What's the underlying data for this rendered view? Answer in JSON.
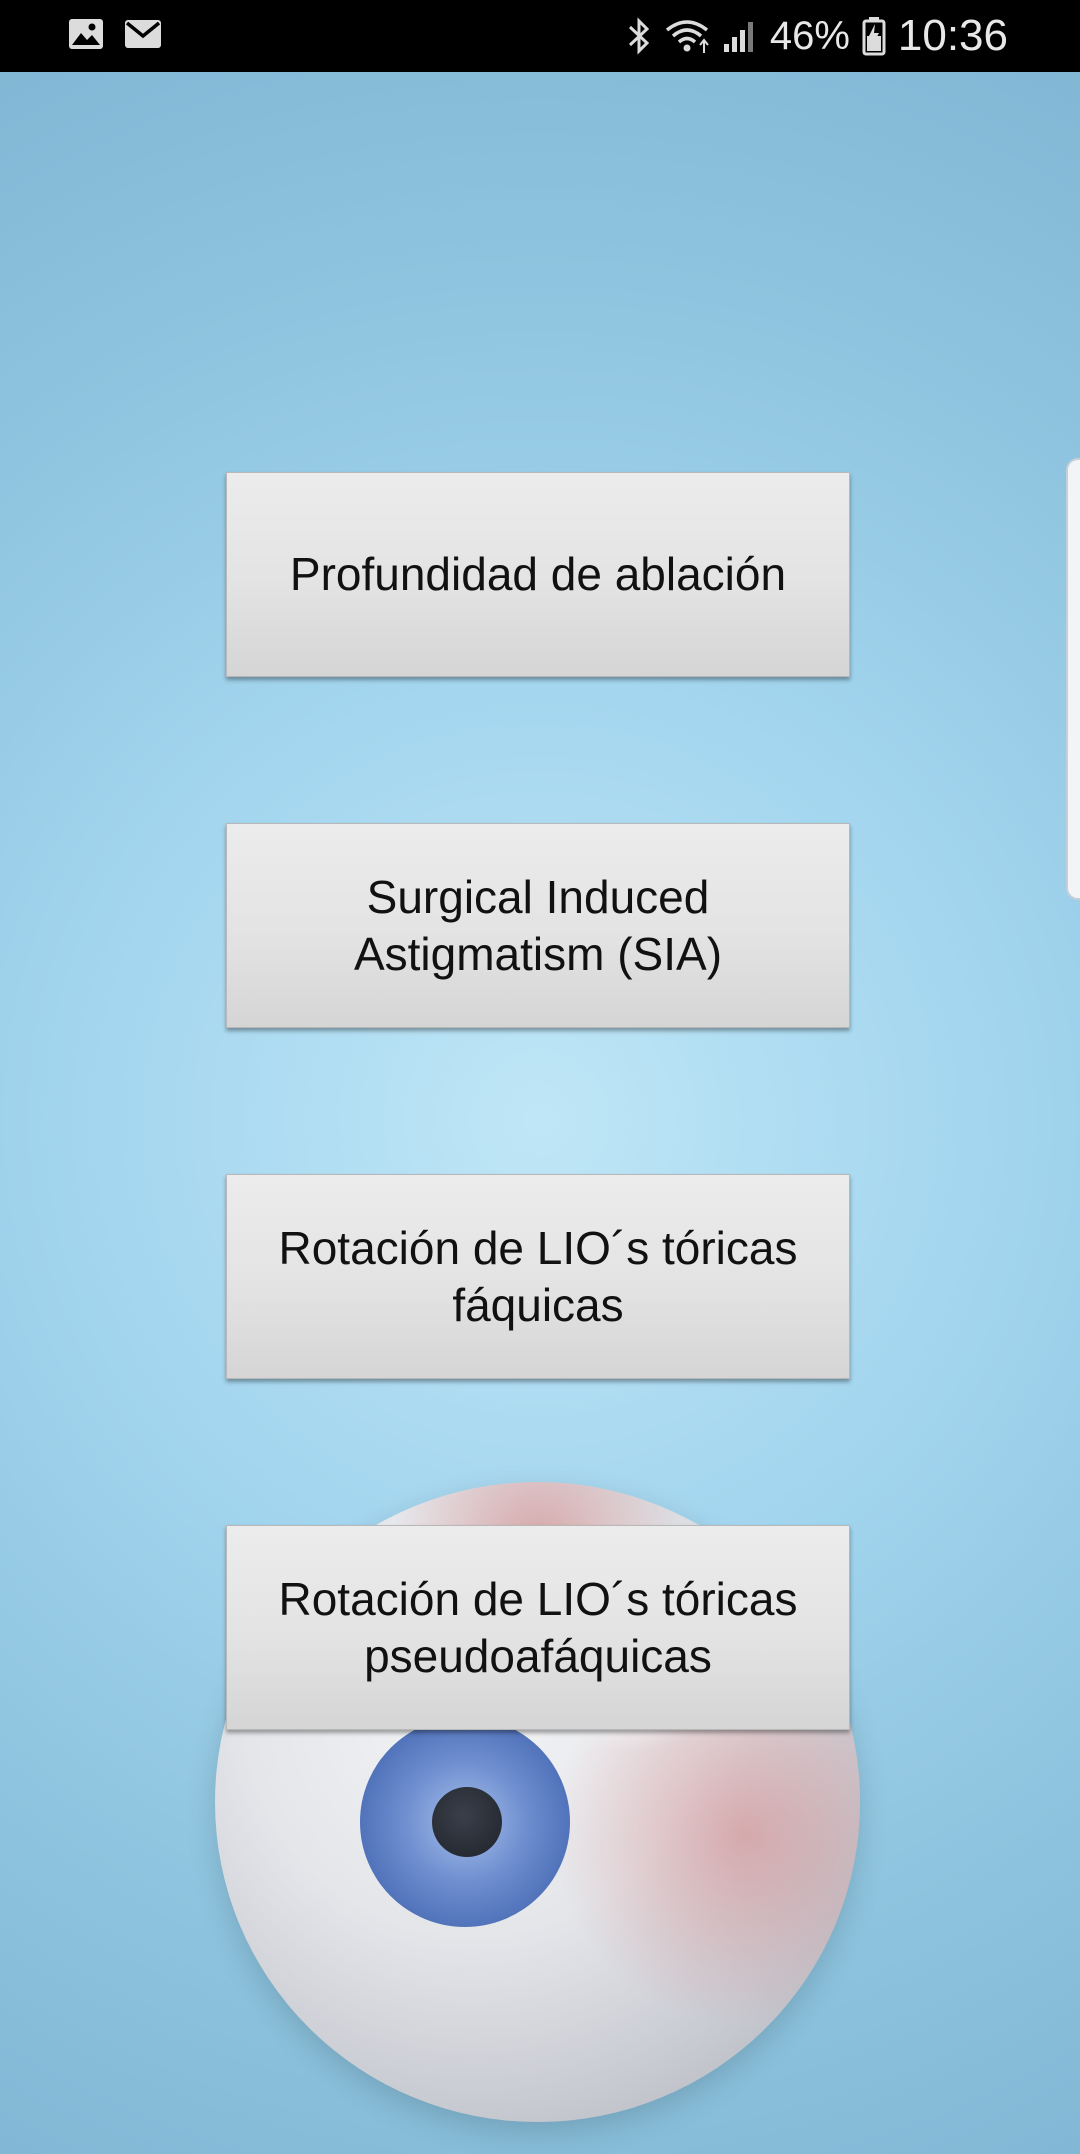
{
  "status_bar": {
    "left_icons": [
      "image-icon",
      "mail-icon"
    ],
    "right_icons": [
      "bluetooth-icon",
      "wifi-icon",
      "signal-icon",
      "battery-icon"
    ],
    "battery_percent": "46%",
    "time": "10:36"
  },
  "menu": {
    "buttons": [
      {
        "label": "Profundidad de ablación"
      },
      {
        "label": "Surgical Induced\nAstigmatism (SIA)"
      },
      {
        "label": "Rotación de LIO´s tóricas\nfáquicas"
      },
      {
        "label": "Rotación de LIO´s tóricas\npseudoafáquicas"
      }
    ]
  },
  "colors": {
    "background_center": "#bfe6f6",
    "background_edge": "#7fb5d2",
    "button_top": "#ececec",
    "button_bottom": "#d5d5d5",
    "status_bar": "#000000",
    "iris": "#4d6fb7"
  }
}
